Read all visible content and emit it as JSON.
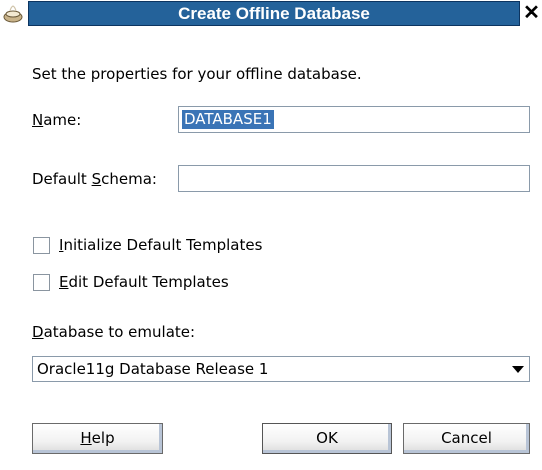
{
  "dialog": {
    "title": "Create Offline Database",
    "close_glyph": "✕",
    "title_icon": "database-cup-icon",
    "colors": {
      "title_bar": "#24629a",
      "selection": "#3a74b6"
    }
  },
  "intro_text": "Set the properties for your offline database.",
  "name_field": {
    "label_mnemonic": "N",
    "label_rest": "ame:",
    "value": "DATABASE1",
    "value_selected": true
  },
  "schema_field": {
    "label_before": "Default ",
    "label_mnemonic": "S",
    "label_rest": "chema:",
    "value": ""
  },
  "checkboxes": [
    {
      "mnemonic": "I",
      "label_rest": "nitialize Default Templates",
      "checked": false
    },
    {
      "mnemonic": "E",
      "label_rest": "dit Default Templates",
      "checked": false
    }
  ],
  "emulate": {
    "label_mnemonic": "D",
    "label_rest": "atabase to emulate:",
    "selected": "Oracle11g Database Release 1"
  },
  "buttons": {
    "help": {
      "mnemonic": "H",
      "rest": "elp"
    },
    "ok": "OK",
    "cancel": "Cancel"
  }
}
